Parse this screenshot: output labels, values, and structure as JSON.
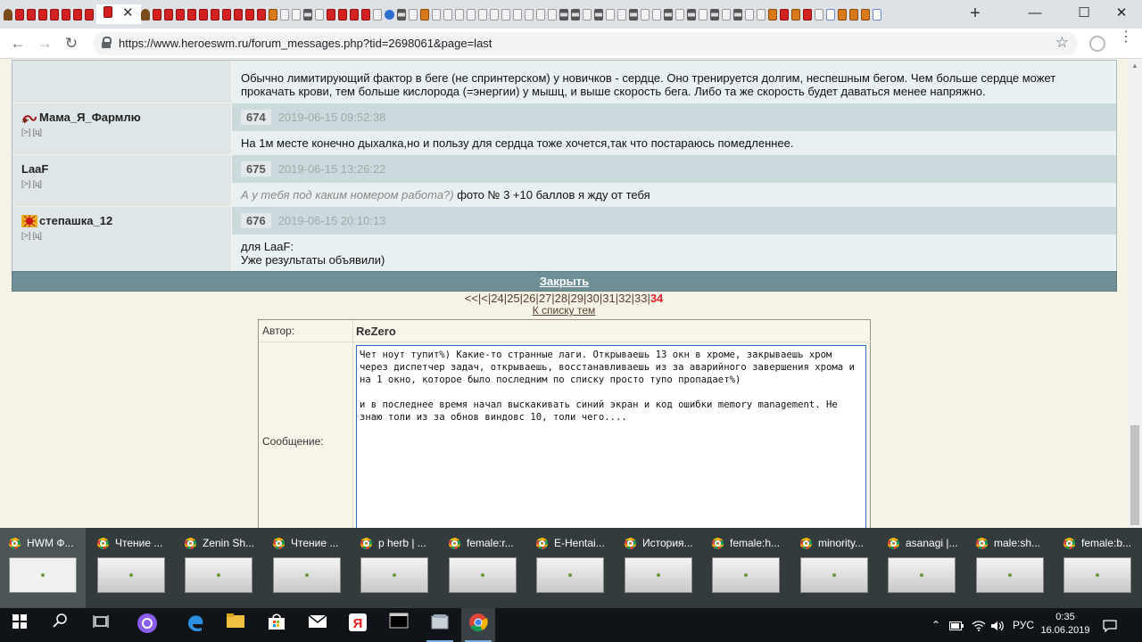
{
  "browser": {
    "url": "https://www.heroeswm.ru/forum_messages.php?tid=2698061&page=last",
    "new_tab": "+",
    "win_minimize": "—",
    "win_maximize": "☐",
    "win_close": "✕",
    "tab_close": "✕",
    "back": "←",
    "forward": "→",
    "reload": "↻",
    "star": "☆",
    "menu": "⋮"
  },
  "posts": [
    {
      "author": "",
      "num": "",
      "date": "",
      "lines": [
        "Обычно лимитирующий фактор в беге (не спринтерском) у новичков - сердце. Оно тренируется долгим, неспешным бегом. Чем больше сердце может",
        "прокачать крови, тем больше кислорода (=энергии) у мышц, и выше скорость бега. Либо та же скорость будет даваться менее напряжно."
      ]
    },
    {
      "author": "Мама_Я_Фармлю",
      "links": "[>] [ц]",
      "num": "674",
      "date": "2019-06-15 09:52:38",
      "lines": [
        "На 1м месте конечно дыхалка,но и пользу для сердца тоже хочется,так что постараюсь помедленнее."
      ]
    },
    {
      "author": "LaaF",
      "links": "[>] [ц]",
      "num": "675",
      "date": "2019-06-15 13:26:22",
      "quote": "А у тебя под каким номером работа?)",
      "lines": [
        " фото № 3 +10 баллов я жду от тебя"
      ]
    },
    {
      "author": "степашка_12",
      "links": "[>] [ц]",
      "num": "676",
      "date": "2019-06-15 20:10:13",
      "lines": [
        "для LaaF:",
        "Уже результаты объявили)"
      ]
    }
  ],
  "close_label": "Закрыть",
  "pager": {
    "prefix": "<<|<|",
    "pages": [
      "24",
      "25",
      "26",
      "27",
      "28",
      "29",
      "30",
      "31",
      "32",
      "33"
    ],
    "current": "34",
    "to_list": "К списку тем"
  },
  "reply": {
    "author_label": "Автор:",
    "author_value": "ReZero",
    "message_label": "Сообщение:",
    "message_text": "Чет ноут тупит%) Какие-то странные лаги. Открываешь 13 окн в хроме, закрываешь хром через диспетчер задач, открываешь, восстанавливаешь из за аварийного завершения хрома и на 1 окно, которое было последним по списку просто тупо пропадает%)\n\nи в последнее время начал выскакивать синий экран и код ошибки memory management. Не знаю толи из за обнов виндовс 10, толи чего...."
  },
  "thumbnails": [
    {
      "title": "HWM Ф..."
    },
    {
      "title": "Чтение ..."
    },
    {
      "title": "Zenin Sh..."
    },
    {
      "title": "Чтение ..."
    },
    {
      "title": "p herb | ..."
    },
    {
      "title": "female:r..."
    },
    {
      "title": "E-Hentai..."
    },
    {
      "title": "История..."
    },
    {
      "title": "female:h..."
    },
    {
      "title": "minority..."
    },
    {
      "title": "asanagi |..."
    },
    {
      "title": "male:sh..."
    },
    {
      "title": "female:b..."
    }
  ],
  "taskbar": {
    "lang": "РУС",
    "time": "0:35",
    "date": "16.06.2019",
    "chevron": "⌃"
  },
  "colors": {
    "forum_header": "#cbdadd",
    "forum_text_bg": "#e9f0f1",
    "close_bar": "#6f8f96",
    "page_bg": "#f5f2e6",
    "current_page": "#d8232a"
  }
}
